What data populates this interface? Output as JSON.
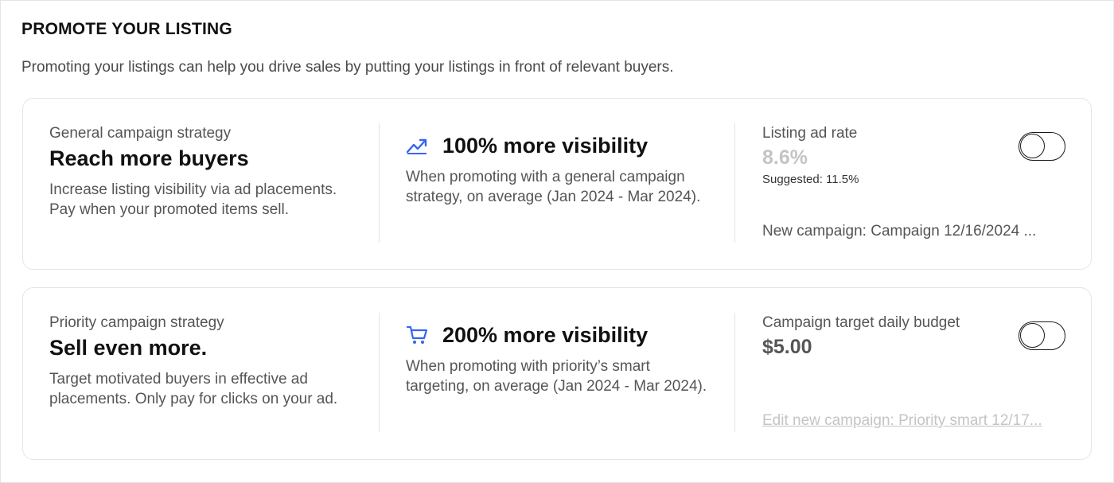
{
  "section": {
    "title": "PROMOTE YOUR LISTING",
    "intro": "Promoting your listings can help you drive sales by putting your listings in front of relevant buyers."
  },
  "general": {
    "eyebrow": "General campaign strategy",
    "headline": "Reach more buyers",
    "description": "Increase listing visibility via ad placements. Pay when your promoted items sell.",
    "stat_icon": "trending-up-icon",
    "stat_title": "100% more visibility",
    "stat_description": "When promoting with a general campaign strategy, on average (Jan 2024 - Mar 2024).",
    "rate_label": "Listing ad rate",
    "rate_value": "8.6%",
    "suggested": "Suggested: 11.5%",
    "campaign_text": "New campaign: Campaign 12/16/2024 ...",
    "toggle_on": false
  },
  "priority": {
    "eyebrow": "Priority campaign strategy",
    "headline": "Sell even more.",
    "description": "Target motivated buyers in effective ad placements. Only pay for clicks on your ad.",
    "stat_icon": "shopping-cart-icon",
    "stat_title": "200% more visibility",
    "stat_description": "When promoting with priority’s smart targeting, on average (Jan 2024 - Mar 2024).",
    "budget_label": "Campaign target daily budget",
    "budget_value": "$5.00",
    "campaign_link": "Edit new campaign: Priority smart 12/17...",
    "toggle_on": false
  },
  "colors": {
    "accent_icon": "#3665f3",
    "muted_text": "#c4c4c4",
    "border": "#e5e5e5"
  }
}
